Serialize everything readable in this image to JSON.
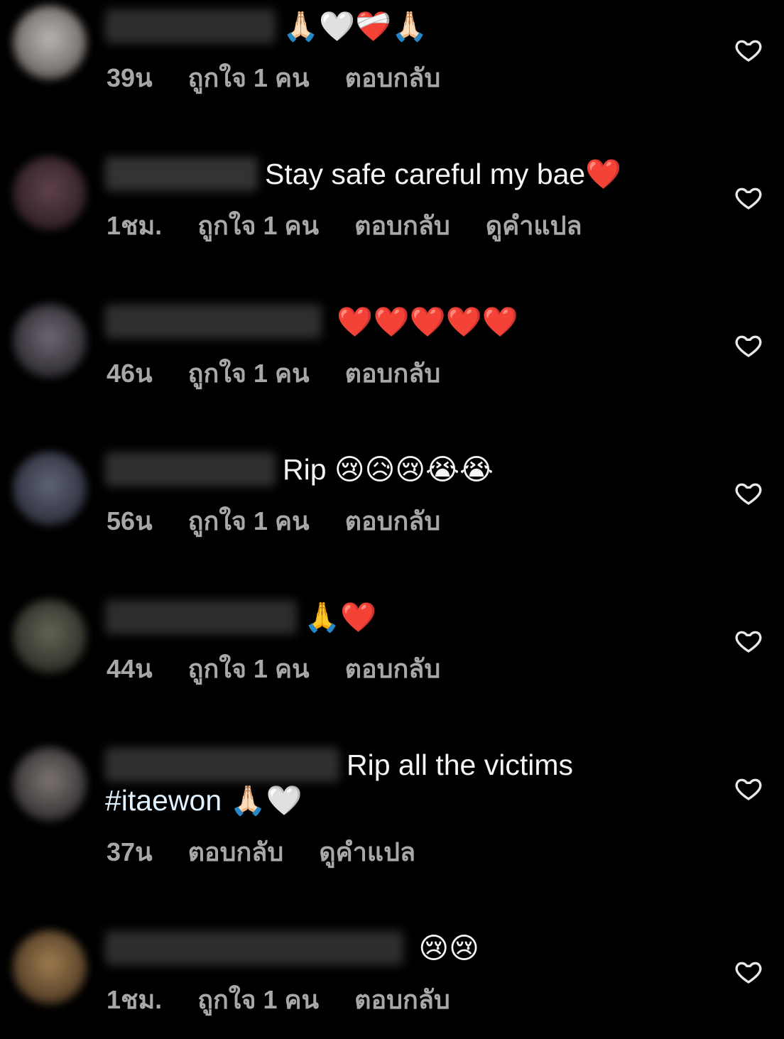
{
  "colors": {
    "background": "#000000",
    "text": "#f5f5f5",
    "meta_text": "#a8a8a8",
    "hashtag": "#e0f1ff"
  },
  "labels": {
    "like_count": "ถูกใจ 1 คน",
    "reply": "ตอบกลับ",
    "translate": "ดูคำแปล"
  },
  "icons": {
    "like": "heart-outline-icon"
  },
  "comments": [
    {
      "text": "🙏🏻🤍❤️‍🩹🙏🏻",
      "time": "39น",
      "likes": "ถูกใจ 1 คน",
      "reply": "ตอบกลับ",
      "translate": ""
    },
    {
      "text": "Stay safe careful my bae❤️",
      "time": "1ชม.",
      "likes": "ถูกใจ 1 คน",
      "reply": "ตอบกลับ",
      "translate": "ดูคำแปล"
    },
    {
      "text": " ❤️❤️❤️❤️❤️",
      "time": "46น",
      "likes": "ถูกใจ 1 คน",
      "reply": "ตอบกลับ",
      "translate": ""
    },
    {
      "text": "Rip 😢😥😢😭😭",
      "time": "56น",
      "likes": "ถูกใจ 1 คน",
      "reply": "ตอบกลับ",
      "translate": ""
    },
    {
      "text": "🙏❤️",
      "time": "44น",
      "likes": "ถูกใจ 1 คน",
      "reply": "ตอบกลับ",
      "translate": ""
    },
    {
      "text": "Rip all the victims",
      "hashtag": "#itaewon",
      "text_after": " 🙏🏻🤍",
      "time": "37น",
      "likes": "",
      "reply": "ตอบกลับ",
      "translate": "ดูคำแปล"
    },
    {
      "text": " 😢😢",
      "time": "1ชม.",
      "likes": "ถูกใจ 1 คน",
      "reply": "ตอบกลับ",
      "translate": ""
    }
  ]
}
